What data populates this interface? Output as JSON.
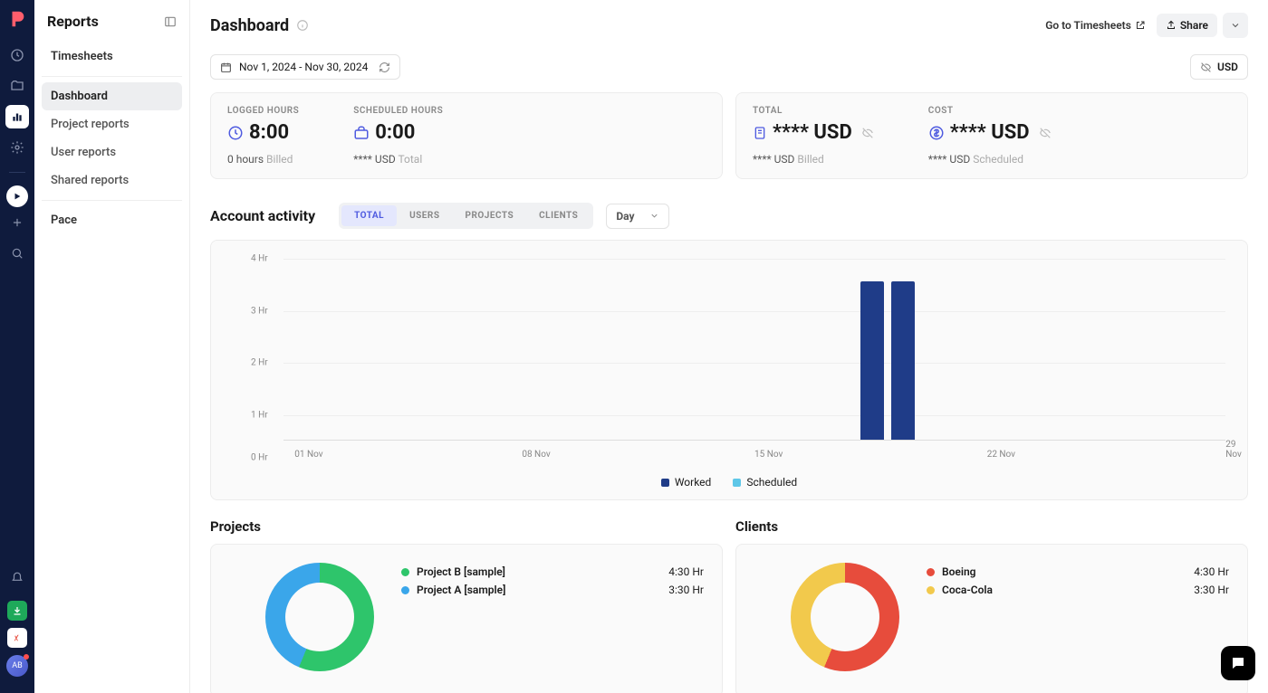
{
  "sidebar": {
    "title": "Reports",
    "items": [
      "Timesheets",
      "Dashboard",
      "Project reports",
      "User reports",
      "Shared reports",
      "Pace"
    ],
    "activeIndex": 1
  },
  "header": {
    "title": "Dashboard",
    "goto": "Go to Timesheets",
    "share": "Share"
  },
  "filters": {
    "date_range": "Nov 1, 2024 - Nov 30, 2024",
    "currency": "USD"
  },
  "stats": {
    "logged": {
      "label": "LOGGED HOURS",
      "value": "8:00",
      "sub_value": "0 hours",
      "sub_label": "Billed"
    },
    "scheduled": {
      "label": "SCHEDULED HOURS",
      "value": "0:00",
      "sub_value": "**** USD",
      "sub_label": "Total"
    },
    "total": {
      "label": "TOTAL",
      "value": "**** USD",
      "sub_value": "**** USD",
      "sub_label": "Billed"
    },
    "cost": {
      "label": "COST",
      "value": "**** USD",
      "sub_value": "**** USD",
      "sub_label": "Scheduled"
    }
  },
  "activity": {
    "title": "Account activity",
    "tabs": [
      "TOTAL",
      "USERS",
      "PROJECTS",
      "CLIENTS"
    ],
    "activeTab": 0,
    "granularity": "Day",
    "legend": {
      "worked": "Worked",
      "scheduled": "Scheduled"
    },
    "colors": {
      "worked": "#1f3c88",
      "scheduled": "#5ec7e8"
    }
  },
  "chart_data": {
    "type": "bar",
    "ylabel": "Hr",
    "ylim": [
      0,
      4
    ],
    "y_ticks": [
      "0 Hr",
      "1 Hr",
      "2 Hr",
      "3 Hr",
      "4 Hr"
    ],
    "x_ticks": [
      "01 Nov",
      "08 Nov",
      "15 Nov",
      "22 Nov",
      "29 Nov"
    ],
    "series": [
      {
        "name": "Worked",
        "color": "#1f3c88",
        "points": [
          {
            "date": "19 Nov",
            "hours": 3.5
          },
          {
            "date": "20 Nov",
            "hours": 3.5
          }
        ]
      }
    ]
  },
  "projects": {
    "title": "Projects",
    "items": [
      {
        "name": "Project B [sample]",
        "hours": "4:30 Hr",
        "color": "#2ec56b"
      },
      {
        "name": "Project A [sample]",
        "hours": "3:30 Hr",
        "color": "#3aa6ea"
      }
    ]
  },
  "clients": {
    "title": "Clients",
    "items": [
      {
        "name": "Boeing",
        "hours": "4:30 Hr",
        "color": "#e74c3c"
      },
      {
        "name": "Coca-Cola",
        "hours": "3:30 Hr",
        "color": "#f2c94c"
      }
    ]
  },
  "avatar": "AB"
}
